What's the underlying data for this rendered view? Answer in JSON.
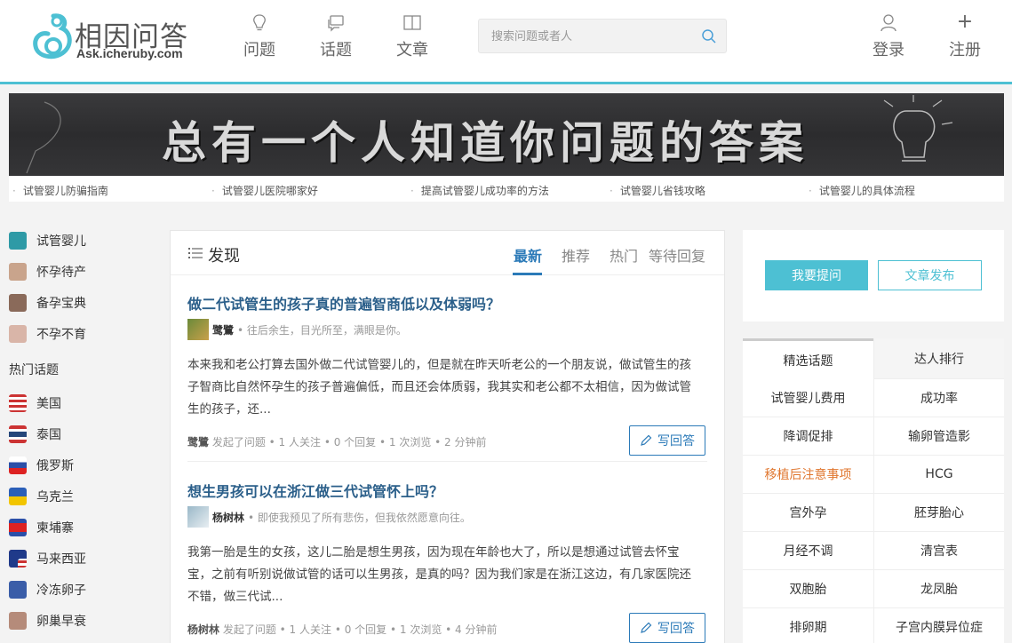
{
  "header": {
    "logo_cn": "相因问答",
    "logo_en": "Ask.icheruby.com",
    "nav": [
      {
        "label": "问题",
        "icon": "lightbulb-icon"
      },
      {
        "label": "话题",
        "icon": "chat-icon"
      },
      {
        "label": "文章",
        "icon": "book-icon"
      }
    ],
    "search_placeholder": "搜索问题或者人",
    "login_label": "登录",
    "register_label": "注册",
    "plus_glyph": "+"
  },
  "banner": {
    "text": "总有一个人知道你问题的答案",
    "quick_links": [
      "试管婴儿防骗指南",
      "试管婴儿医院哪家好",
      "提高试管婴儿成功率的方法",
      "试管婴儿省钱攻略",
      "试管婴儿的具体流程"
    ]
  },
  "left": {
    "categories": [
      "试管婴儿",
      "怀孕待产",
      "备孕宝典",
      "不孕不育"
    ],
    "hot_title": "热门话题",
    "hot_topics": [
      "美国",
      "泰国",
      "俄罗斯",
      "乌克兰",
      "柬埔寨",
      "马来西亚",
      "冷冻卵子",
      "卵巢早衰"
    ]
  },
  "main": {
    "title": "发现",
    "tabs": [
      "最新",
      "推荐",
      "热门",
      "等待回复"
    ],
    "answer_label": "写回答",
    "questions": [
      {
        "title": "做二代试管生的孩子真的普遍智商低以及体弱吗？",
        "author": "鹭鷺",
        "signature": "• 往后余生，目光所至，满眼是你。",
        "body": "本来我和老公打算去国外做二代试管婴儿的，但是就在昨天听老公的一个朋友说，做试管生的孩子智商比自然怀孕生的孩子普遍偏低，而且还会体质弱，我其实和老公都不太相信，因为做试管生的孩子，还...",
        "stats_author": "鹭鷺",
        "stats": "发起了问题 • 1 人关注 • 0 个回复 • 1 次浏览 • 2 分钟前"
      },
      {
        "title": "想生男孩可以在浙江做三代试管怀上吗？",
        "author": "杨树林",
        "signature": "• 即使我预见了所有悲伤，但我依然愿意向往。",
        "body": "我第一胎是生的女孩，这儿二胎是想生男孩，因为现在年龄也大了，所以是想通过试管去怀宝宝，之前有听别说做试管的话可以生男孩，是真的吗？因为我们家是在浙江这边，有几家医院还不错，做三代试...",
        "stats_author": "杨树林",
        "stats": "发起了问题 • 1 人关注 • 0 个回复 • 1 次浏览 • 4 分钟前"
      }
    ]
  },
  "right": {
    "ask_label": "我要提问",
    "article_label": "文章发布",
    "tabs": [
      "精选话题",
      "达人排行"
    ],
    "topics": [
      "试管婴儿费用",
      "成功率",
      "降调促排",
      "输卵管造影",
      "移植后注意事项",
      "HCG",
      "宫外孕",
      "胚芽胎心",
      "月经不调",
      "清宫表",
      "双胞胎",
      "龙凤胎",
      "排卵期",
      "子宫内膜异位症"
    ],
    "highlight_color": "#e0762e"
  },
  "colors": {
    "accent": "#4dc0d3",
    "link": "#2b7ab8"
  }
}
